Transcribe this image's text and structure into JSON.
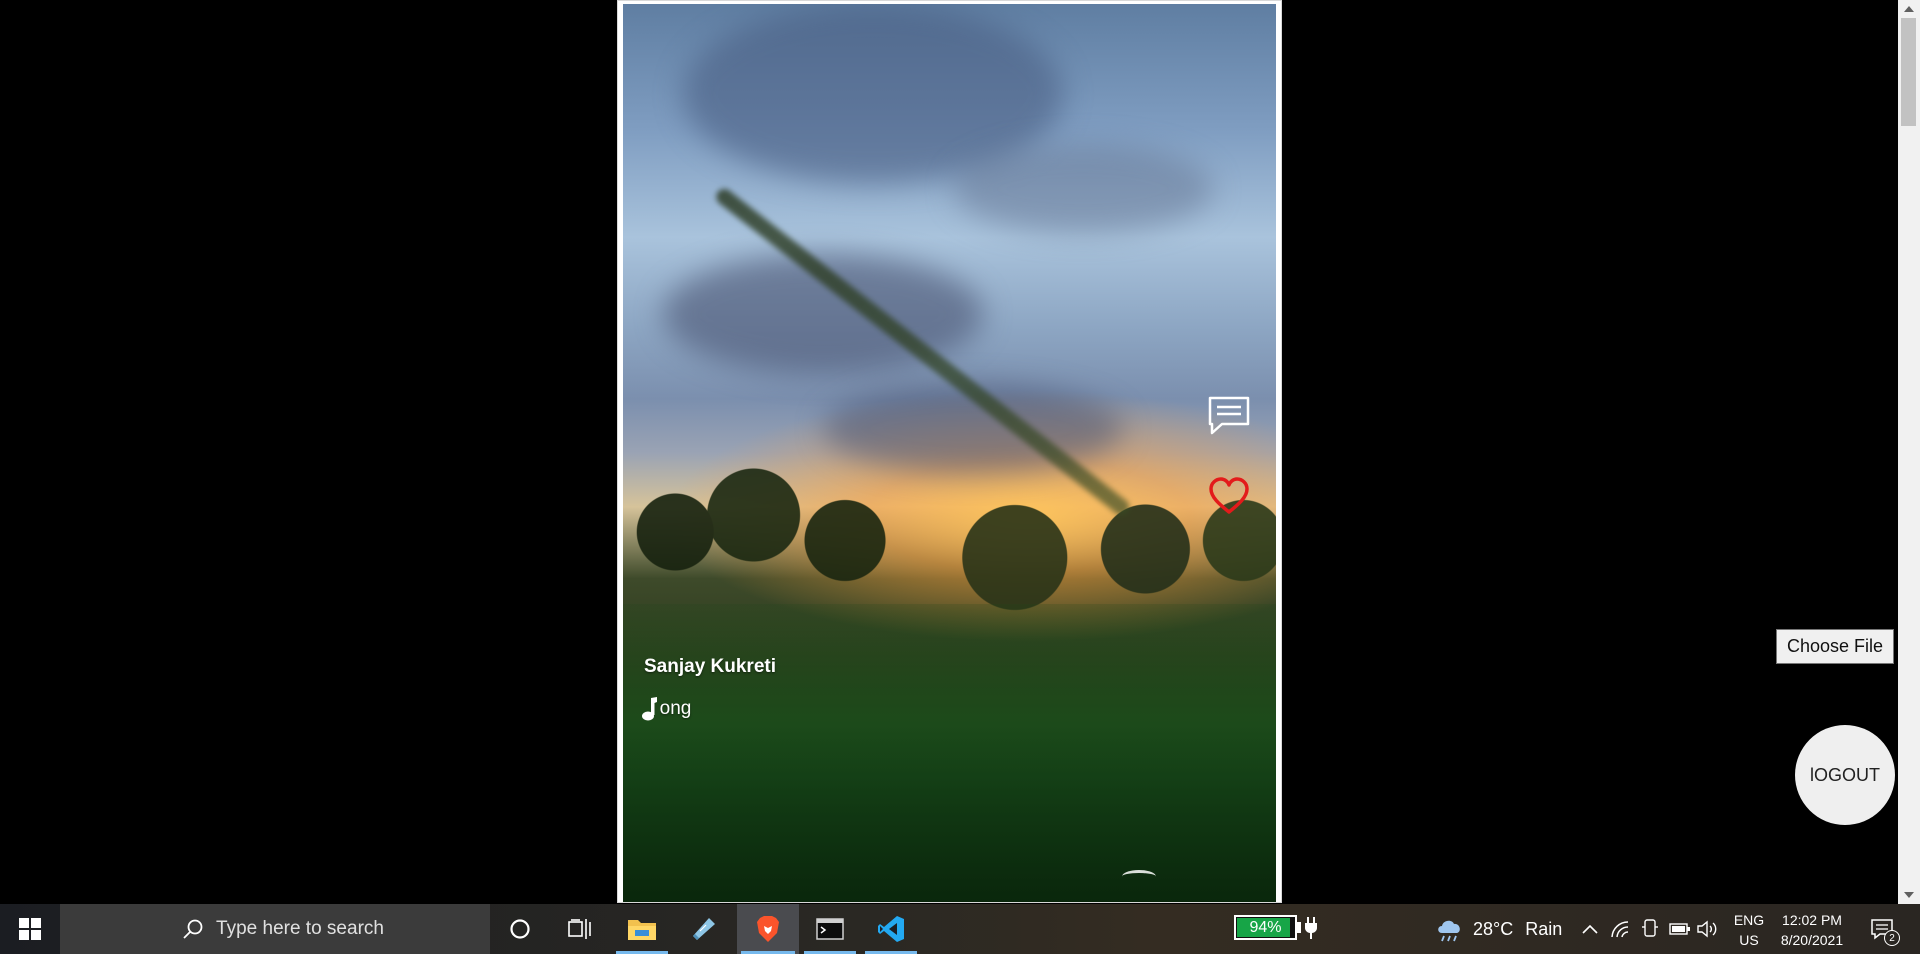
{
  "video_card": {
    "author": "Sanjay Kukreti",
    "song": "Song",
    "comment_icon": "comment-icon",
    "like_icon": "heart-outline-icon",
    "like_color": "#e31b1b"
  },
  "actions": {
    "choose_file_label": "Choose File",
    "logout_label": "lOGOUT"
  },
  "taskbar": {
    "search_placeholder": "Type here to search",
    "battery_percent": "94%",
    "battery_level": 0.94,
    "weather_temp": "28°C",
    "weather_condition": "Rain",
    "language_line1": "ENG",
    "language_line2": "US",
    "time": "12:02 PM",
    "date": "8/20/2021",
    "notification_count": "2",
    "accent": "#76b9ed",
    "battery_color": "#17a547"
  }
}
